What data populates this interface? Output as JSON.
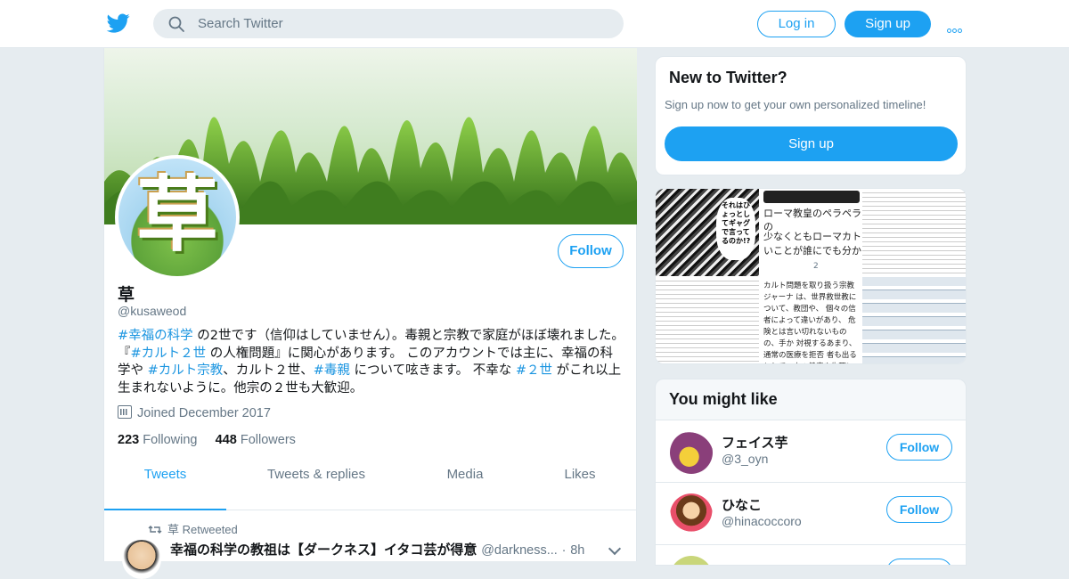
{
  "header": {
    "search_placeholder": "Search Twitter",
    "login_label": "Log in",
    "signup_label": "Sign up"
  },
  "profile": {
    "avatar_text": "草",
    "name": "草",
    "handle": "@kusaweod",
    "follow_label": "Follow",
    "bio": [
      {
        "text": "#幸福の科学",
        "link": true
      },
      {
        "text": " の2世です（信仰はしていません）。毒親と宗教で家庭がほぼ壊れました。 『",
        "link": false
      },
      {
        "text": "#カルト２世",
        "link": true
      },
      {
        "text": " の人権問題』に関心があります。 このアカウントでは主に、幸福の科学や ",
        "link": false
      },
      {
        "text": "#カルト宗教",
        "link": true
      },
      {
        "text": "、カルト２世、",
        "link": false
      },
      {
        "text": "#毒親",
        "link": true
      },
      {
        "text": " について呟きます。 不幸な ",
        "link": false
      },
      {
        "text": "#２世",
        "link": true
      },
      {
        "text": " がこれ以上生まれないように。他宗の２世も大歓迎。",
        "link": false
      }
    ],
    "joined": "Joined December 2017",
    "following_count": "223",
    "following_label": "Following",
    "followers_count": "448",
    "followers_label": "Followers"
  },
  "tabs": [
    {
      "label": "Tweets",
      "active": true
    },
    {
      "label": "Tweets & replies",
      "active": false
    },
    {
      "label": "Media",
      "active": false
    },
    {
      "label": "Likes",
      "active": false
    }
  ],
  "tweet": {
    "retweeted_by": "草 Retweeted",
    "author_name": "幸福の科学の教祖は【ダークネス】イタコ芸が得意",
    "author_handle": "@darkness...",
    "time": "8h"
  },
  "new_to_twitter": {
    "title": "New to Twitter?",
    "subtitle": "Sign up now to get your own personalized timeline!",
    "button": "Sign up"
  },
  "media": {
    "manga_text": "それはひょっとしてギャグで言ってるのか!?",
    "tweet_snip_1": "ローマ教皇のペラペラの",
    "tweet_snip_2": "少なくともローマカト",
    "tweet_snip_3": "いことが誰にでも分か",
    "tweet_snip_count": "2",
    "wiki_snip": "カルト問題を取り扱う宗教ジャーナ は、世界救世教について、教団や、 個々の信者によって違いがあり、 危険とは言い切れないものの、手か 対視するあまり、通常の医療を拒否 者も出るとして、人の健康や生死に た一群であるとする"
  },
  "you_might_like": {
    "title": "You might like",
    "accounts": [
      {
        "name": "フェイス芋",
        "handle": "@3_oyn",
        "follow_label": "Follow"
      },
      {
        "name": "ひなこ",
        "handle": "@hinacoccoro",
        "follow_label": "Follow"
      },
      {
        "name": "",
        "handle": "",
        "follow_label": ""
      }
    ]
  },
  "colors": {
    "accent": "#1da1f2",
    "link": "#1b95e0",
    "muted": "#657786",
    "border": "#e1e8ed",
    "background": "#e6ecf0"
  },
  "icons": [
    "twitter-bird-icon",
    "search-icon",
    "more-dots-icon",
    "calendar-icon",
    "retweet-icon",
    "chevron-down-icon"
  ]
}
